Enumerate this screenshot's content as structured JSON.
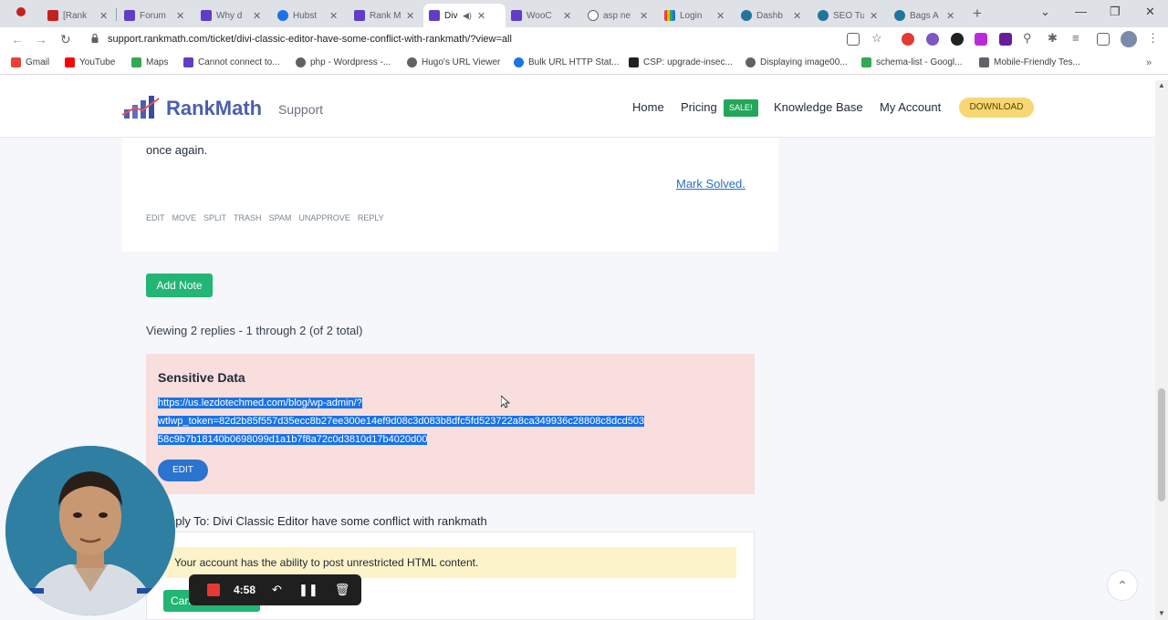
{
  "browser": {
    "tabs": [
      {
        "title": "[Rank",
        "color": "#c5221f"
      },
      {
        "title": "Forum",
        "color": "#5f3dc4"
      },
      {
        "title": "Why d",
        "color": "#5f3dc4"
      },
      {
        "title": "Hubst",
        "color": "#1a73e8"
      },
      {
        "title": "Rank M",
        "color": "#5f3dc4"
      },
      {
        "title": "Div",
        "color": "#5f3dc4"
      },
      {
        "title": "WooC",
        "color": "#5f3dc4"
      },
      {
        "title": "asp ne",
        "color": "#5f6368"
      },
      {
        "title": "Login",
        "color": "#34a853"
      },
      {
        "title": "Dashb",
        "color": "#21759b"
      },
      {
        "title": "SEO Tu",
        "color": "#21759b"
      },
      {
        "title": "Bags A",
        "color": "#21759b"
      }
    ],
    "url": "support.rankmath.com/ticket/divi-classic-editor-have-some-conflict-with-rankmath/?view=all",
    "bookmarks": [
      {
        "label": "Gmail",
        "color": "#ea4335"
      },
      {
        "label": "YouTube",
        "color": "#ff0000"
      },
      {
        "label": "Maps",
        "color": "#34a853"
      },
      {
        "label": "Cannot connect to...",
        "color": "#5f3dc4"
      },
      {
        "label": "php - Wordpress -...",
        "color": "#5f6368"
      },
      {
        "label": "Hugo's URL Viewer",
        "color": "#5f6368"
      },
      {
        "label": "Bulk URL HTTP Stat...",
        "color": "#1a73e8"
      },
      {
        "label": "CSP: upgrade-insec...",
        "color": "#202124"
      },
      {
        "label": "Displaying image00...",
        "color": "#5f6368"
      },
      {
        "label": "schema-list - Googl...",
        "color": "#34a853"
      },
      {
        "label": "Mobile-Friendly Tes...",
        "color": "#5f6368"
      }
    ]
  },
  "site": {
    "logo": "RankMath",
    "logo_sub": "Support",
    "nav": {
      "home": "Home",
      "pricing": "Pricing",
      "sale": "SALE!",
      "kb": "Knowledge Base",
      "account": "My Account",
      "download": "DOWNLOAD"
    }
  },
  "ticket": {
    "text_tail": "once again.",
    "mark_solved": "Mark Solved.",
    "admin_links": [
      "EDIT",
      "MOVE",
      "SPLIT",
      "TRASH",
      "SPAM",
      "UNAPPROVE",
      "REPLY"
    ],
    "add_note": "Add Note",
    "viewing": "Viewing 2 replies - 1 through 2 (of 2 total)"
  },
  "sensitive": {
    "title": "Sensitive Data",
    "line1": "https://us.lezdotechmed.com/blog/wp-admin/?",
    "line2": "wtlwp_token=82d2b85f557d35ecc8b27ee300e14ef9d08c3d083b8dfc5fd523722a8ca349936c28808c8dcd503",
    "line3": "58c9b7b18140b0698099d1a1b7f8a72c0d3810d17b4020d00",
    "edit": "EDIT"
  },
  "reply": {
    "heading": "eply To: Divi Classic Editor have some conflict with rankmath",
    "notice": "Your account has the ability to post unrestricted HTML content.",
    "cancel": "Can"
  },
  "recorder": {
    "time": "4:58"
  },
  "colors": {
    "brand": "#4b5fb0",
    "green": "#22b573",
    "selection": "#1a73e8",
    "sensitive_bg": "#f9dede"
  }
}
